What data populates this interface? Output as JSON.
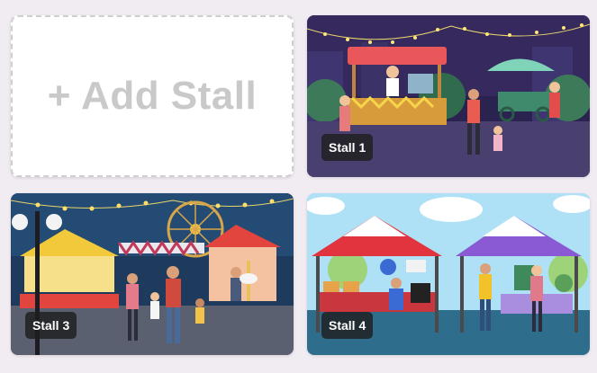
{
  "add_stall": {
    "label": "+ Add Stall"
  },
  "stalls": [
    {
      "label": "Stall 1",
      "scene": "night market food stalls"
    },
    {
      "label": "Stall 3",
      "scene": "carnival fairground at night"
    },
    {
      "label": "Stall 4",
      "scene": "daytime flea market tents"
    }
  ],
  "colors": {
    "page_bg": "#f1ebf2",
    "badge_bg": "#1e1e1e",
    "add_text": "#c9c9c9"
  }
}
